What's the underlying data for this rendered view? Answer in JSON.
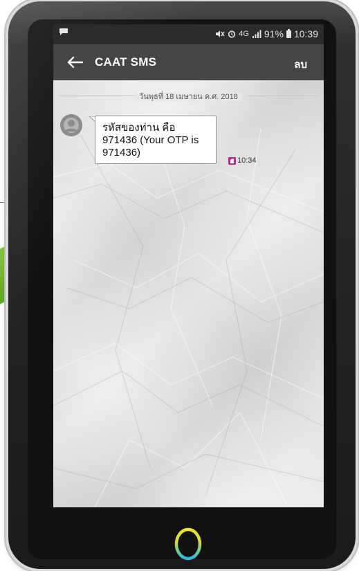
{
  "status_bar": {
    "network_small": "4G",
    "battery_percent": "91%",
    "time": "10:39"
  },
  "toolbar": {
    "title": "CAAT SMS",
    "delete_label": "ลบ"
  },
  "conversation": {
    "date_divider": "วันพุธที่ 18 เมษายน ค.ศ. 2018",
    "messages": [
      {
        "lines": [
          "รหัสของท่าน คือ",
          "971436 (Your OTP is",
          "971436)"
        ],
        "time": "10:34",
        "sim_icon": "sim-card-icon"
      }
    ]
  },
  "colors": {
    "status_bar": "#2b2b2b",
    "toolbar": "#454545",
    "sim_badge": "#b0318a",
    "home_ring_top": "#f2e23a",
    "home_ring_bottom": "#2bb6d8"
  }
}
